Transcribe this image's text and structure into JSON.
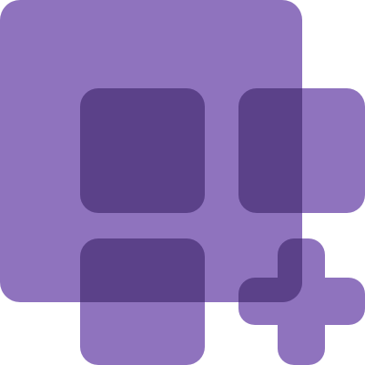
{
  "icon": {
    "name": "add-app-grid-icon",
    "colors": {
      "primary": "#8F73BE",
      "overlap": "#5B4189"
    }
  }
}
